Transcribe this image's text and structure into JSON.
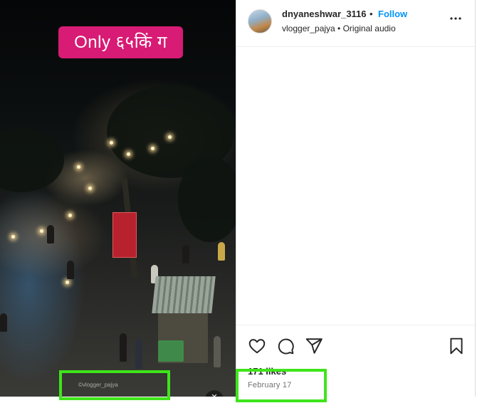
{
  "video": {
    "caption_overlay": "Only ६५किं ग",
    "watermark": "©vlogger_pajya"
  },
  "post": {
    "username": "dnyaneshwar_3116",
    "separator": "•",
    "follow_label": "Follow",
    "audio_line": "vlogger_pajya • Original audio",
    "more_label": "•••",
    "likes": "171 likes",
    "date": "February 17"
  },
  "icons": {
    "like": "heart-icon",
    "comment": "comment-icon",
    "share": "share-icon",
    "save": "bookmark-icon",
    "more": "more-options-icon",
    "mute": "mute-icon"
  },
  "colors": {
    "follow": "#0095f6",
    "caption_chip": "#d81b74",
    "highlight": "#3ee51a"
  }
}
